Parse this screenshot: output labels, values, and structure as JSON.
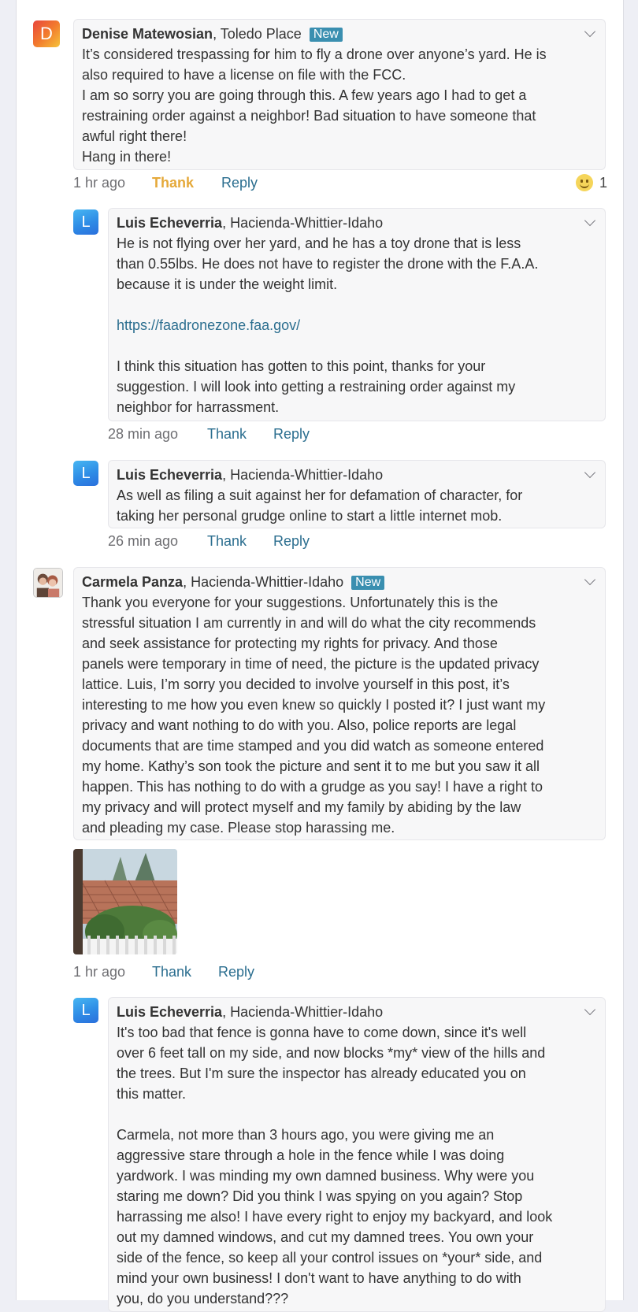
{
  "comments": [
    {
      "author": "Denise Matewosian",
      "location": ", Toledo Place",
      "badge": "New",
      "avatar_letter": "D",
      "lines": [
        "It’s considered trespassing for him to fly a drone over anyone’s yard. He is",
        "also required to have a license on file with the FCC.",
        "I am so sorry you are going through this. A few years ago I had to get a",
        "restraining order against a neighbor! Bad situation to have someone that",
        "awful right there!",
        "Hang in there!"
      ],
      "time": "1 hr ago",
      "thank": "Thank",
      "reply": "Reply",
      "reaction_count": "1",
      "reaction_icon": "smiley-face-icon"
    },
    {
      "author": "Luis Echeverria",
      "location": ", Hacienda-Whittier-Idaho",
      "avatar_letter": "L",
      "lines": [
        "He is not flying over her yard, and he has a toy drone that is less",
        "than 0.55lbs. He does not have to register the drone with the F.A.A.",
        "because it is under the weight limit.",
        "",
        "https://faadronezone.faa.gov/",
        "",
        "I think this situation has gotten to this point, thanks for your",
        "suggestion. I will look into getting a restraining order against my",
        "neighbor for harrassment."
      ],
      "time": "28 min ago",
      "thank": "Thank",
      "reply": "Reply"
    },
    {
      "author": "Luis Echeverria",
      "location": ", Hacienda-Whittier-Idaho",
      "avatar_letter": "L",
      "lines": [
        "As well as filing a suit against her for defamation of character, for",
        "taking her personal grudge online to start a little internet mob."
      ],
      "time": "26 min ago",
      "thank": "Thank",
      "reply": "Reply"
    },
    {
      "author": "Carmela Panza",
      "location": ", Hacienda-Whittier-Idaho",
      "badge": "New",
      "lines": [
        "Thank you everyone for your suggestions. Unfortunately this is the",
        "stressful situation I am currently in and will do what the city recommends",
        "and seek assistance for protecting my rights for privacy. And those",
        "panels were temporary in time of need, the picture is the updated privacy",
        "lattice. Luis, I’m sorry you decided to involve yourself in this post, it’s",
        "interesting to me how you even knew so quickly I posted it? I just want my",
        "privacy and want nothing to do with you. Also, police reports are legal",
        "documents that are time stamped and you did watch as someone entered",
        "my home. Kathy’s son took the picture and sent it to me but you saw it all",
        "happen. This has nothing to do with a grudge as you say! I have a right to",
        "my privacy and will protect myself and my family by abiding by the law",
        "and pleading my case. Please stop harassing me."
      ],
      "time": "1 hr ago",
      "thank": "Thank",
      "reply": "Reply"
    },
    {
      "author": "Luis Echeverria",
      "location": ", Hacienda-Whittier-Idaho",
      "avatar_letter": "L",
      "lines": [
        "It's too bad that fence is gonna have to come down, since it's well",
        "over 6 feet tall on my side, and now blocks *my* view of the hills and",
        "the trees. But I'm sure the inspector has already educated you on",
        "this matter.",
        "",
        "Carmela, not more than 3 hours ago, you were giving me an",
        "aggressive stare through a hole in the fence while I was doing",
        "yardwork. I was minding my own damned business. Why were you",
        "staring me down? Did you think I was spying on you again? Stop",
        "harrassing me also! I have every right to enjoy my backyard, and look",
        "out my damned windows, and cut my damned trees. You own your",
        "side of the fence, so keep all your control issues on *your* side, and",
        "mind your own business! I don't want to have anything to do with",
        "you, do you understand???"
      ]
    }
  ]
}
